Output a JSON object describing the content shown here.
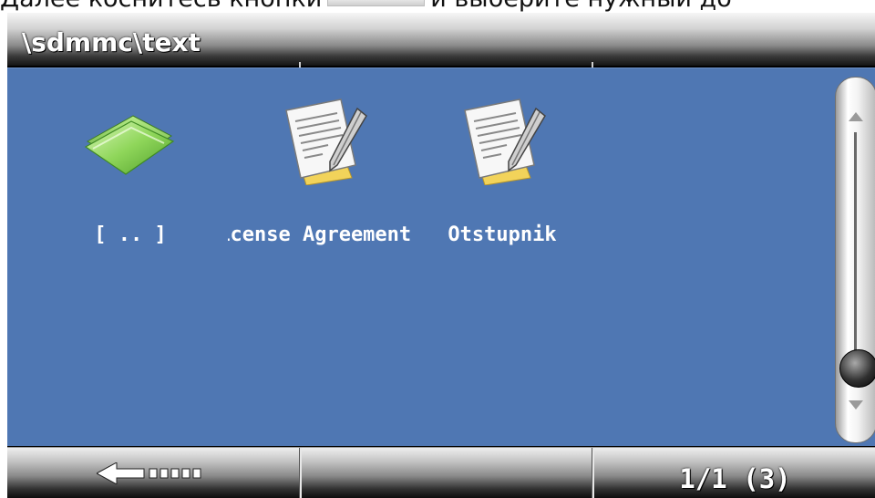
{
  "document_text": {
    "before": "Далее коснитесь кнопки",
    "after": "и выберите нужный до"
  },
  "window": {
    "title": "\\sdmmc\\text"
  },
  "files": [
    {
      "label": "[ .. ]",
      "icon": "folder-up-icon",
      "type": "parent-folder"
    },
    {
      "label": "License Agreement",
      "icon": "text-document-icon",
      "type": "text"
    },
    {
      "label": "Otstupnik",
      "icon": "text-document-icon",
      "type": "text"
    }
  ],
  "footer": {
    "back_icon": "back-arrow-icon",
    "page_counter": "1/1 (3)"
  }
}
